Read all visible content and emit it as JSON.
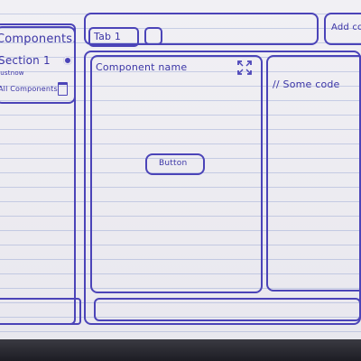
{
  "sidebar": {
    "title": "Components.",
    "section": {
      "label": "Section 1",
      "meta": "Justnow"
    },
    "all_label": "All Components"
  },
  "tabs": [
    {
      "label": "Tab 1"
    }
  ],
  "header": {
    "add_label": "Add co"
  },
  "component": {
    "name_label": "Component name",
    "button_label": "Button"
  },
  "code": {
    "text": "// Some code"
  }
}
